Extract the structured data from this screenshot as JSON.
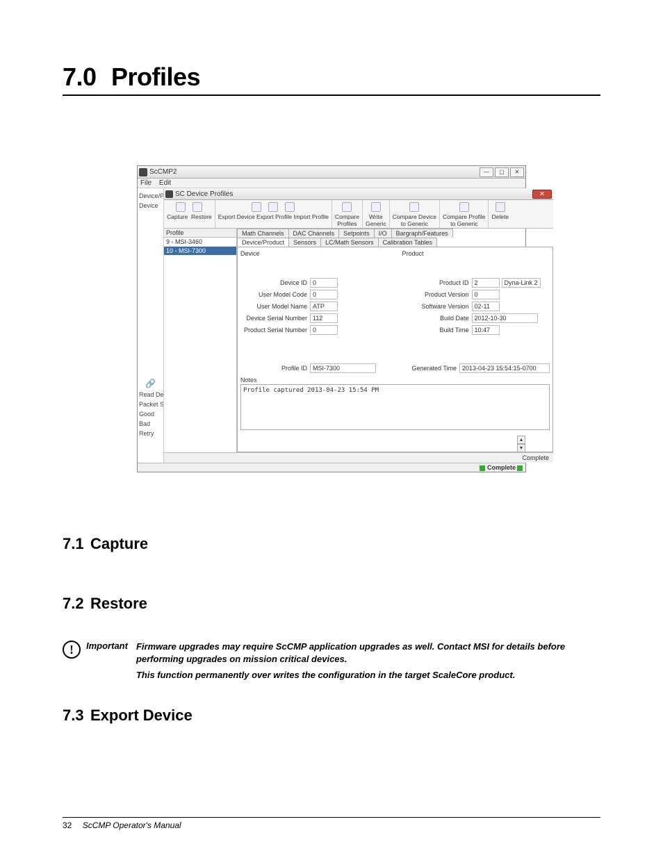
{
  "heading": {
    "num": "7.0",
    "title": "Profiles"
  },
  "sections": [
    {
      "num": "7.1",
      "title": "Capture"
    },
    {
      "num": "7.2",
      "title": "Restore"
    },
    {
      "num": "7.3",
      "title": "Export Device"
    }
  ],
  "important": {
    "label": "Important",
    "line1": "Firmware upgrades may require ScCMP application upgrades as well. Contact MSI for details before performing upgrades on mission critical devices.",
    "line2": "This function permanently over writes the configuration in the target ScaleCore product."
  },
  "footer": {
    "page": "32",
    "doc": "ScCMP Operator's Manual"
  },
  "app": {
    "outer_title": "ScCMP2",
    "menubar": [
      "File",
      "Edit"
    ],
    "left_rail": [
      "Device/P",
      "Device",
      "Read Dev",
      "Packet St",
      "Good",
      "Bad",
      "Retry"
    ],
    "popup_title": "SC Device Profiles",
    "win_buttons": [
      "—",
      "▢",
      "✕"
    ],
    "toolbar": [
      {
        "labels": [
          "Capture",
          "Restore"
        ]
      },
      {
        "labels": [
          "Export Device",
          "Export Profile",
          "Import Profile"
        ]
      },
      {
        "labels": [
          "Compare",
          "Profiles"
        ]
      },
      {
        "labels": [
          "Write",
          "Generic"
        ]
      },
      {
        "labels": [
          "Compare Device",
          "to Generic"
        ]
      },
      {
        "labels": [
          "Compare Profile",
          "to Generic"
        ]
      },
      {
        "labels": [
          "Delete"
        ]
      }
    ],
    "profile_header": "Profile",
    "profiles": [
      {
        "label": "9 - MSI-3460",
        "selected": false
      },
      {
        "label": "10 - MSI-7300",
        "selected": true
      }
    ],
    "tabs_row1": [
      "Math Channels",
      "DAC Channels",
      "Setpoints",
      "I/O",
      "Bargraph/Features"
    ],
    "tabs_row2": [
      "Device/Product",
      "Sensors",
      "LC/Math Sensors",
      "Calibration Tables"
    ],
    "active_tab": "Device/Product",
    "device_section": "Device",
    "product_section": "Product",
    "fields_left": [
      {
        "label": "Device ID",
        "value": "0"
      },
      {
        "label": "User Model Code",
        "value": "0"
      },
      {
        "label": "User Model Name",
        "value": "ATP"
      },
      {
        "label": "Device Serial Number",
        "value": "112"
      },
      {
        "label": "Product Serial Number",
        "value": "0"
      }
    ],
    "fields_right": [
      {
        "label": "Product ID",
        "value": "2",
        "extra": "Dyna-Link 2"
      },
      {
        "label": "Product Version",
        "value": "0"
      },
      {
        "label": "Software Version",
        "value": "02-11"
      },
      {
        "label": "Build Date",
        "value": "2012-10-30"
      },
      {
        "label": "Build Time",
        "value": "10:47"
      }
    ],
    "profile_id_label": "Profile ID",
    "profile_id_value": "MSI-7300",
    "gen_time_label": "Generated Time",
    "gen_time_value": "2013-04-23 15:54:15-0700",
    "notes_label": "Notes",
    "notes_value": "Profile captured 2013-04-23 15:54 PM",
    "status_inner": "Complete",
    "status_outer": "Complete"
  }
}
